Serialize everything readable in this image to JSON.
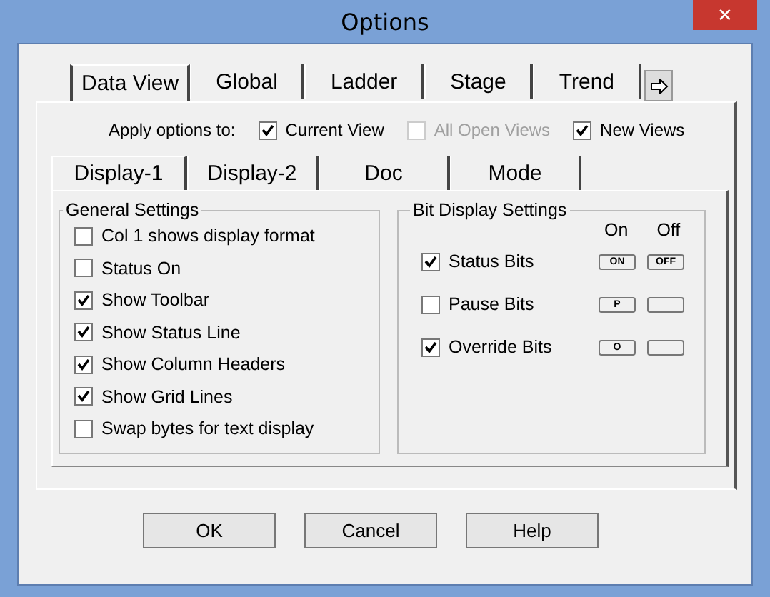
{
  "window": {
    "title": "Options",
    "close": "✕"
  },
  "tabs": [
    {
      "label": "Data View",
      "selected": true
    },
    {
      "label": "Global",
      "selected": false
    },
    {
      "label": "Ladder",
      "selected": false
    },
    {
      "label": "Stage",
      "selected": false
    },
    {
      "label": "Trend",
      "selected": false
    }
  ],
  "apply": {
    "label": "Apply options to:",
    "options": [
      {
        "label": "Current View",
        "checked": true,
        "disabled": false
      },
      {
        "label": "All Open Views",
        "checked": false,
        "disabled": true
      },
      {
        "label": "New Views",
        "checked": true,
        "disabled": false
      }
    ]
  },
  "subtabs": [
    {
      "label": "Display-1",
      "selected": true
    },
    {
      "label": "Display-2",
      "selected": false
    },
    {
      "label": "Doc",
      "selected": false
    },
    {
      "label": "Mode",
      "selected": false
    }
  ],
  "general": {
    "title": "General Settings",
    "items": [
      {
        "label": "Col 1 shows display format",
        "checked": false
      },
      {
        "label": "Status On",
        "checked": false
      },
      {
        "label": "Show Toolbar",
        "checked": true
      },
      {
        "label": "Show Status Line",
        "checked": true
      },
      {
        "label": "Show Column Headers",
        "checked": true
      },
      {
        "label": "Show Grid Lines",
        "checked": true
      },
      {
        "label": "Swap bytes for text display",
        "checked": false
      }
    ]
  },
  "bits": {
    "title": "Bit Display Settings",
    "on_header": "On",
    "off_header": "Off",
    "items": [
      {
        "label": "Status Bits",
        "checked": true,
        "on": "ON",
        "off": "OFF"
      },
      {
        "label": "Pause Bits",
        "checked": false,
        "on": "P"
      },
      {
        "label": "Override Bits",
        "checked": true,
        "on": "O"
      }
    ]
  },
  "buttons": [
    "OK",
    "Cancel",
    "Help"
  ]
}
